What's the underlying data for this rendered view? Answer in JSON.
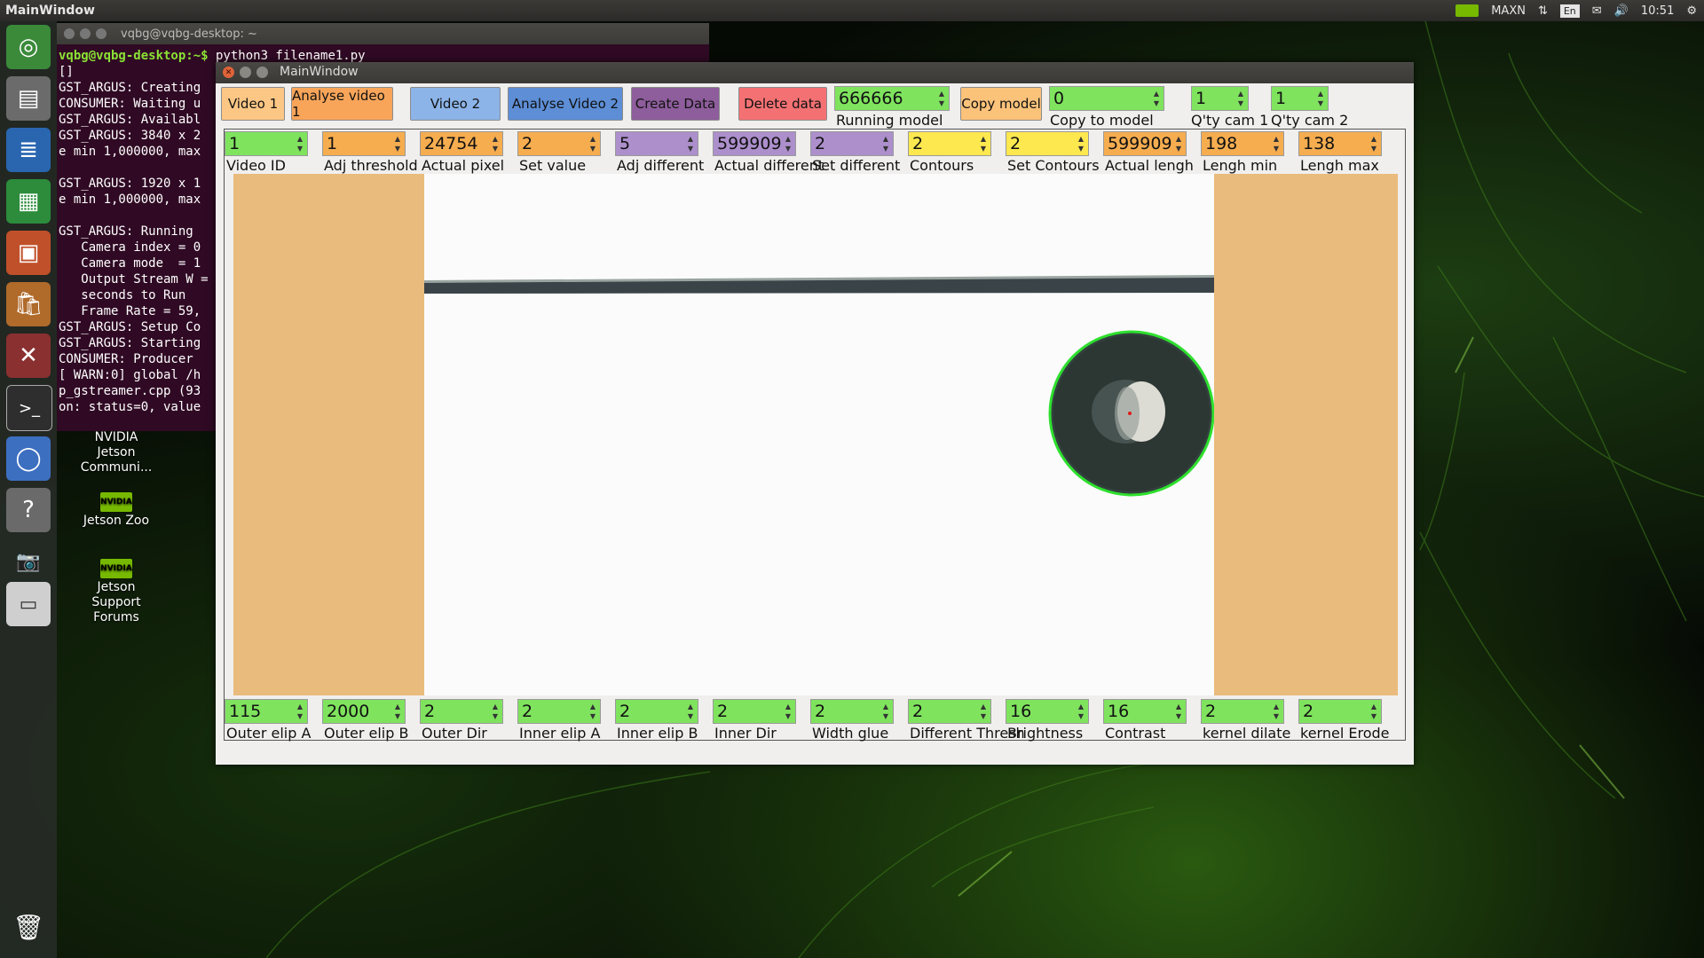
{
  "top_panel": {
    "app_title": "MainWindow",
    "power_mode": "MAXN",
    "keyboard_layout": "En",
    "clock": "10:51",
    "icons": [
      "nvidia-icon",
      "network-icon",
      "keyboard-icon",
      "mail-icon",
      "volume-icon",
      "settings-gear-icon"
    ]
  },
  "launcher": {
    "items": [
      "ubuntu-home-icon",
      "files-icon",
      "writer-icon",
      "calc-icon",
      "impress-icon",
      "software-center-icon",
      "settings-icon",
      "terminal-icon",
      "chromium-icon",
      "help-icon",
      "screenshot-icon",
      "drive-icon",
      "trash-icon"
    ]
  },
  "terminal": {
    "title": "vqbg@vqbg-desktop: ~",
    "prompt": "vqbg@vqbg-desktop:~$",
    "command": " python3 filename1.py",
    "lines": [
      "[]",
      "GST_ARGUS: Creating",
      "CONSUMER: Waiting u",
      "GST_ARGUS: Availabl",
      "GST_ARGUS: 3840 x 2",
      "e min 1,000000, max",
      "",
      "GST_ARGUS: 1920 x 1",
      "e min 1,000000, max",
      "",
      "GST_ARGUS: Running",
      "   Camera index = 0",
      "   Camera mode  = 1",
      "   Output Stream W =",
      "   seconds to Run",
      "   Frame Rate = 59,",
      "GST_ARGUS: Setup Co",
      "GST_ARGUS: Starting",
      "CONSUMER: Producer",
      "[ WARN:0] global /h",
      "p_gstreamer.cpp (93",
      "on: status=0, value"
    ]
  },
  "desktop_icons": [
    {
      "label_lines": [
        "NVIDIA",
        "Jetson",
        "Communi..."
      ]
    },
    {
      "badge": "NVIDIA",
      "label_lines": [
        "Jetson Zoo"
      ]
    },
    {
      "badge": "NVIDIA",
      "label_lines": [
        "Jetson",
        "Support",
        "Forums"
      ]
    }
  ],
  "window": {
    "title": "MainWindow",
    "buttons": {
      "video1": "Video 1",
      "analyse_video1": "Analyse video 1",
      "video2": "Video 2",
      "analyse_video2": "Analyse  Video 2",
      "create_data": "Create Data",
      "delete_data": "Delete data",
      "copy_model": "Copy model"
    },
    "colors": {
      "video1": "#fcc784",
      "analyse_video1": "#f8a55a",
      "video2": "#8cb4e8",
      "analyse_video2": "#5d8ed6",
      "create_data": "#8e5d9c",
      "delete_data": "#f47173",
      "copy_model": "#fbc27a"
    },
    "top_fields": [
      {
        "value": "666666",
        "label": "Running model"
      },
      {
        "value": "0",
        "label": "Copy to model"
      },
      {
        "value": "1",
        "label": "Q'ty cam 1"
      },
      {
        "value": "1",
        "label": "Q'ty cam 2"
      }
    ],
    "row1": [
      {
        "value": "1",
        "label": "Video ID",
        "color": "green"
      },
      {
        "value": "1",
        "label": "Adj threshold",
        "color": "orange"
      },
      {
        "value": "24754",
        "label": "Actual pixel",
        "color": "orange"
      },
      {
        "value": "2",
        "label": "Set value",
        "color": "orange"
      },
      {
        "value": "5",
        "label": "Adj different",
        "color": "purple"
      },
      {
        "value": "599909",
        "label": "Actual different",
        "color": "purple"
      },
      {
        "value": "2",
        "label": "Set different",
        "color": "purple"
      },
      {
        "value": "2",
        "label": "Contours",
        "color": "yellow"
      },
      {
        "value": "2",
        "label": "Set Contours",
        "color": "yellow"
      },
      {
        "value": "599909",
        "label": "Actual lengh",
        "color": "orange"
      },
      {
        "value": "198",
        "label": "Lengh min",
        "color": "orange"
      },
      {
        "value": "138",
        "label": "Lengh max",
        "color": "orange"
      }
    ],
    "row2": [
      {
        "value": "115",
        "label": "Outer elip A"
      },
      {
        "value": "2000",
        "label": "Outer elip B"
      },
      {
        "value": "2",
        "label": "Outer Dir"
      },
      {
        "value": "2",
        "label": "Inner elip A"
      },
      {
        "value": "2",
        "label": "Inner elip B"
      },
      {
        "value": "2",
        "label": "Inner Dir"
      },
      {
        "value": "2",
        "label": "Width glue"
      },
      {
        "value": "2",
        "label": "Different Thresh"
      },
      {
        "value": "16",
        "label": "Brightness"
      },
      {
        "value": "16",
        "label": "Contrast"
      },
      {
        "value": "2",
        "label": "kernel dilate"
      },
      {
        "value": "2",
        "label": "kernel Erode"
      }
    ]
  }
}
